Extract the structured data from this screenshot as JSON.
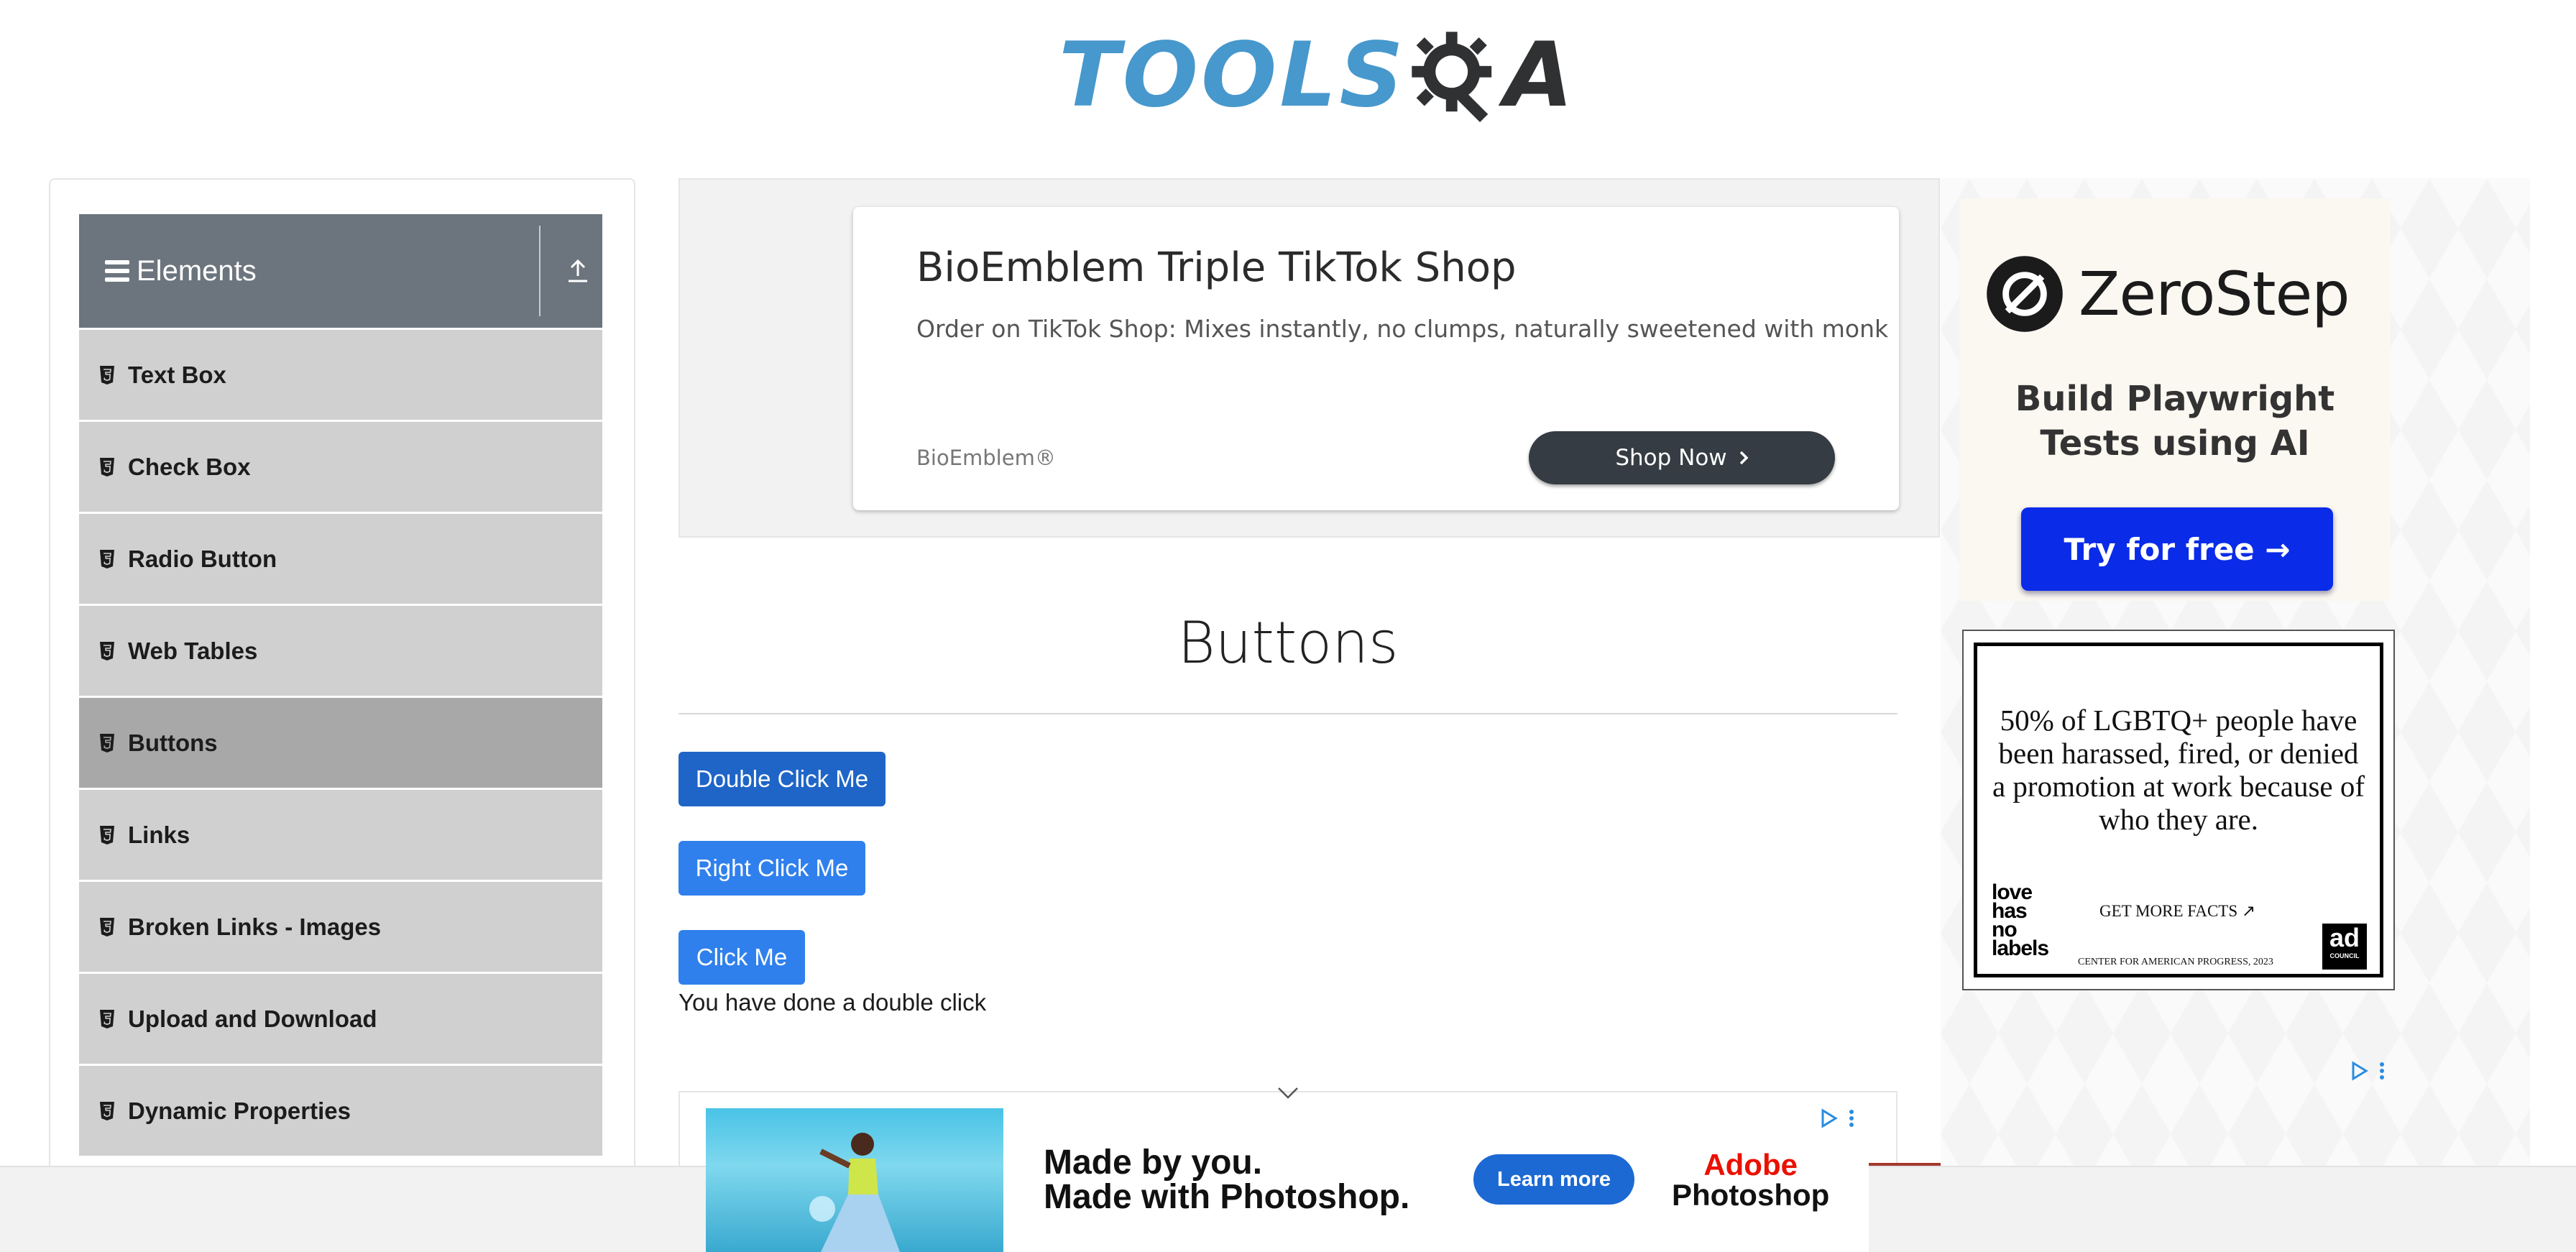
{
  "header": {
    "logo_tools": "TOOLS",
    "logo_a": "A"
  },
  "sidebar": {
    "group_title": "Elements",
    "items": [
      {
        "label": "Text Box",
        "active": false
      },
      {
        "label": "Check Box",
        "active": false
      },
      {
        "label": "Radio Button",
        "active": false
      },
      {
        "label": "Web Tables",
        "active": false
      },
      {
        "label": "Buttons",
        "active": true
      },
      {
        "label": "Links",
        "active": false
      },
      {
        "label": "Broken Links - Images",
        "active": false
      },
      {
        "label": "Upload and Download",
        "active": false
      },
      {
        "label": "Dynamic Properties",
        "active": false
      }
    ]
  },
  "top_ad": {
    "title": "BioEmblem Triple TikTok Shop",
    "description": "Order on TikTok Shop: Mixes instantly, no clumps, naturally sweetened with monk",
    "brand": "BioEmblem®",
    "cta": "Shop Now"
  },
  "main": {
    "title": "Buttons",
    "double_click_button": "Double Click Me",
    "right_click_button": "Right Click Me",
    "click_button": "Click Me",
    "result_message": "You have done a double click"
  },
  "right_ad_zerostep": {
    "brand": "ZeroStep",
    "tagline_line1": "Build Playwright",
    "tagline_line2": "Tests using AI",
    "cta": "Try for free →"
  },
  "right_ad_lgbt": {
    "text": "50% of LGBTQ+ people have been harassed, fired, or denied a promotion at work because of who they are.",
    "love_line1": "love",
    "love_line2": "has",
    "love_line3": "no",
    "love_line4": "labels",
    "facts": "GET MORE FACTS ↗",
    "source": "CENTER FOR AMERICAN PROGRESS, 2023",
    "adcouncil_main": "ad",
    "adcouncil_sub": "COUNCIL"
  },
  "bottom_ad": {
    "headline_line1": "Made by you.",
    "headline_line2": "Made with Photoshop.",
    "cta": "Learn more",
    "brand_line1": "Adobe",
    "brand_line2": "Photoshop"
  },
  "colors": {
    "sidebar_header": "#6c757d",
    "menu_item": "#d0d0d0",
    "menu_item_active": "#a8a8a8",
    "primary_button": "#2f80ed",
    "focused_button": "#1f65c7",
    "logo_blue": "#4798cc",
    "zerostep_cta": "#0a2be8"
  }
}
